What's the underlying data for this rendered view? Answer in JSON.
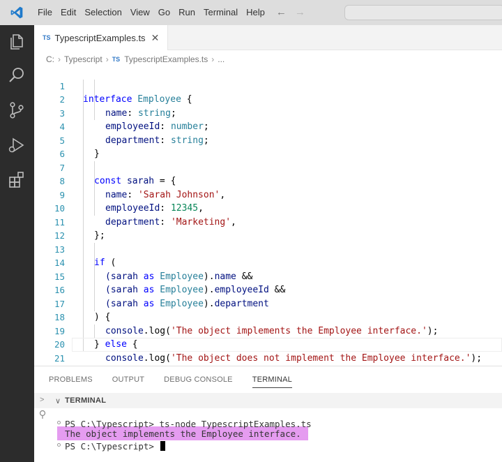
{
  "menu": [
    "File",
    "Edit",
    "Selection",
    "View",
    "Go",
    "Run",
    "Terminal",
    "Help"
  ],
  "nav": {
    "back": "←",
    "forward": "→"
  },
  "tab": {
    "badge": "TS",
    "label": "TypescriptExamples.ts",
    "close": "✕"
  },
  "breadcrumb": [
    "C:",
    "Typescript",
    "TS",
    "TypescriptExamples.ts",
    "..."
  ],
  "line_numbers": [
    "1",
    "2",
    "3",
    "4",
    "5",
    "6",
    "7",
    "8",
    "9",
    "10",
    "11",
    "12",
    "13",
    "14",
    "15",
    "16",
    "17",
    "18",
    "19",
    "20",
    "21"
  ],
  "code": {
    "l1": [
      "interface",
      " ",
      "Employee",
      " {"
    ],
    "l2": [
      "name",
      ": ",
      "string",
      ";"
    ],
    "l3": [
      "employeeId",
      ": ",
      "number",
      ";"
    ],
    "l4": [
      "department",
      ": ",
      "string",
      ";"
    ],
    "l5": [
      "}"
    ],
    "l7": [
      "const",
      " ",
      "sarah",
      " = {"
    ],
    "l8": [
      "name",
      ": ",
      "'Sarah Johnson'",
      ","
    ],
    "l9": [
      "employeeId",
      ": ",
      "12345",
      ","
    ],
    "l10": [
      "department",
      ": ",
      "'Marketing'",
      ","
    ],
    "l11": [
      "};"
    ],
    "l13": [
      "if",
      " ("
    ],
    "l14": [
      "(sarah",
      " as ",
      "Employee",
      ").",
      "name",
      " &&"
    ],
    "l15": [
      "(sarah",
      " as ",
      "Employee",
      ").",
      "employeeId",
      " &&"
    ],
    "l16": [
      "(sarah",
      " as ",
      "Employee",
      ").",
      "department"
    ],
    "l17": [
      ") {"
    ],
    "l18": [
      "console",
      ".",
      "log",
      "(",
      "'The object implements the Employee interface.'",
      ");"
    ],
    "l19": [
      "} ",
      "else",
      " {"
    ],
    "l20": [
      "console",
      ".",
      "log",
      "(",
      "'The object does not implement the Employee interface.'",
      ");"
    ],
    "l21": [
      "}"
    ]
  },
  "panel": {
    "tabs": [
      "PROBLEMS",
      "OUTPUT",
      "DEBUG CONSOLE",
      "TERMINAL"
    ],
    "terminal_title": "TERMINAL",
    "chevron_side": ">",
    "chevron_down": "∨"
  },
  "terminal": {
    "line1": "PS C:\\Typescript> ts-node TypescriptExamples.ts",
    "line2": "The object implements the Employee interface.",
    "line3": "PS C:\\Typescript> "
  },
  "colors": {
    "activity_bar": "#2c2c2c",
    "keyword": "#0000ff",
    "type": "#267f99",
    "property": "#001080",
    "string": "#a31515",
    "number": "#098658",
    "line_number": "#2b91af",
    "terminal_highlight": "#e59cf0"
  }
}
